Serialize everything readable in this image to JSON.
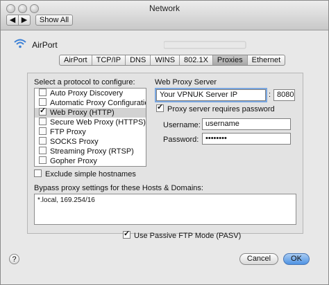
{
  "window": {
    "title": "Network"
  },
  "toolbar": {
    "back": "◀",
    "forward": "▶",
    "show_all": "Show All"
  },
  "interface": {
    "name": "AirPort"
  },
  "tabs": [
    {
      "label": "AirPort"
    },
    {
      "label": "TCP/IP"
    },
    {
      "label": "DNS"
    },
    {
      "label": "WINS"
    },
    {
      "label": "802.1X"
    },
    {
      "label": "Proxies",
      "selected": true
    },
    {
      "label": "Ethernet"
    }
  ],
  "protocols": {
    "label": "Select a protocol to configure:",
    "items": [
      {
        "label": "Auto Proxy Discovery",
        "checked": false
      },
      {
        "label": "Automatic Proxy Configuration",
        "checked": false
      },
      {
        "label": "Web Proxy (HTTP)",
        "checked": true,
        "selected": true
      },
      {
        "label": "Secure Web Proxy (HTTPS)",
        "checked": false
      },
      {
        "label": "FTP Proxy",
        "checked": false
      },
      {
        "label": "SOCKS Proxy",
        "checked": false
      },
      {
        "label": "Streaming Proxy (RTSP)",
        "checked": false
      },
      {
        "label": "Gopher Proxy",
        "checked": false
      }
    ]
  },
  "exclude_simple": {
    "label": "Exclude simple hostnames",
    "checked": false
  },
  "server": {
    "label": "Web Proxy Server",
    "host_value": "Your VPNUK Server IP",
    "separator": ":",
    "port_value": "8080",
    "requires_password_label": "Proxy server requires password",
    "requires_password_checked": true,
    "username_label": "Username:",
    "username_value": "username",
    "password_label": "Password:",
    "password_value": "••••••••"
  },
  "bypass": {
    "label": "Bypass proxy settings for these Hosts & Domains:",
    "value": "*.local, 169.254/16"
  },
  "passive_ftp": {
    "label": "Use Passive FTP Mode (PASV)",
    "checked": true
  },
  "buttons": {
    "help": "?",
    "cancel": "Cancel",
    "ok": "OK"
  },
  "colors": {
    "ok_button": "#4f93e3",
    "focus_ring": "#7aa7e0",
    "window_bg": "#e8e8e8"
  }
}
